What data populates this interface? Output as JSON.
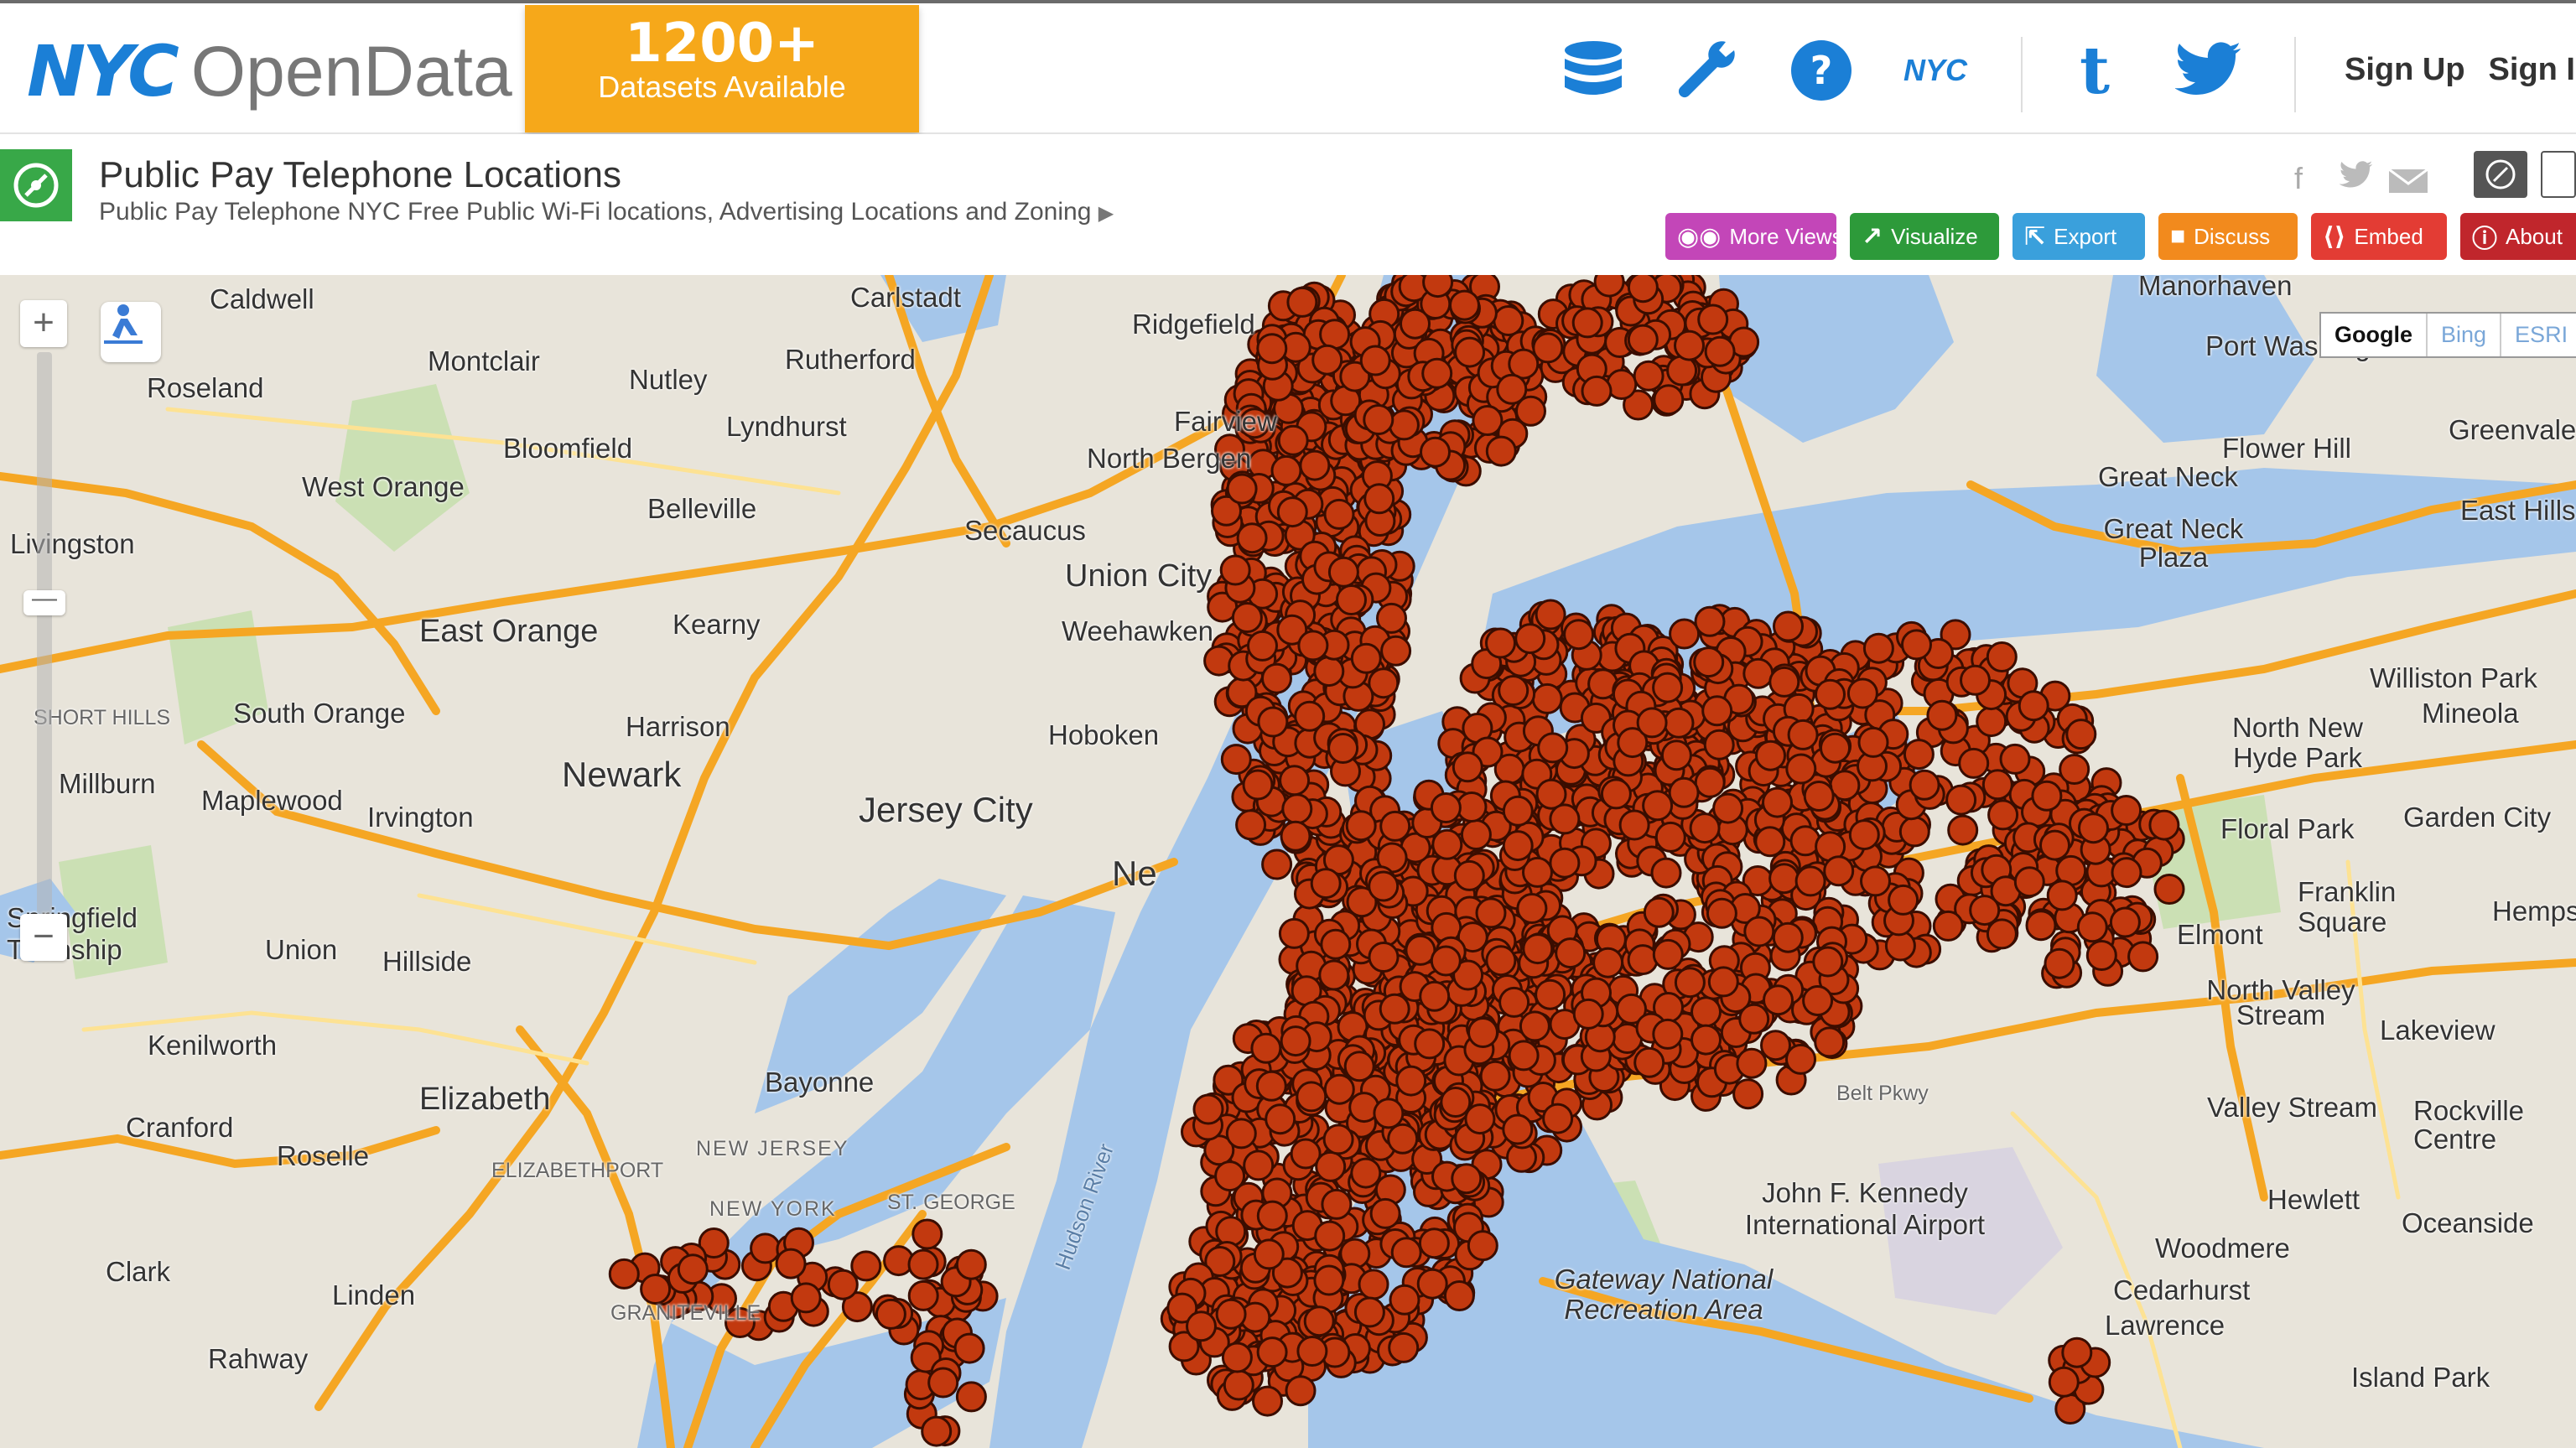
{
  "header": {
    "logo_nyc": "NYC",
    "logo_opendata": "OpenData",
    "badge_count": "1200+",
    "badge_text": "Datasets Available",
    "icons": [
      "database-icon",
      "wrench-icon",
      "help-icon",
      "nyc-icon",
      "tumblr-icon",
      "twitter-icon"
    ],
    "nyc_icon_text": "NYC",
    "tumblr_icon_text": "t",
    "sign_up": "Sign Up",
    "sign_in": "Sign In"
  },
  "dataset": {
    "title": "Public Pay Telephone Locations",
    "subtitle": "Public Pay Telephone NYC Free Public Wi-Fi locations, Advertising Locations and Zoning",
    "share_icons": [
      "facebook-icon",
      "twitter-icon",
      "email-icon"
    ],
    "buttons": [
      {
        "label": "More Views",
        "color": "#c346b8",
        "icon": "binoculars-icon"
      },
      {
        "label": "Visualize",
        "color": "#2d9a3a",
        "icon": "chart-icon"
      },
      {
        "label": "Export",
        "color": "#3aa0dc",
        "icon": "export-icon"
      },
      {
        "label": "Discuss",
        "color": "#f28a1d",
        "icon": "speech-icon"
      },
      {
        "label": "Embed",
        "color": "#e33c34",
        "icon": "code-icon"
      },
      {
        "label": "About",
        "color": "#c0262c",
        "icon": "info-icon"
      }
    ]
  },
  "map": {
    "providers": [
      "Google",
      "Bing",
      "ESRI"
    ],
    "selected_provider": "Google",
    "zoom_in": "+",
    "zoom_out": "−",
    "water_color": "#a5c6ea",
    "land_color": "#e8e4da",
    "marker_color": "#c2390f",
    "labels": [
      "Caldwell",
      "Carlstadt",
      "Ridgefield",
      "Manorhaven",
      "Port Washington",
      "Roseland",
      "Montclair",
      "Nutley",
      "Rutherford",
      "Lyndhurst",
      "Fairview",
      "North Bergen",
      "Greenvale",
      "Flower Hill",
      "Great Neck",
      "East Hills",
      "Great Neck Plaza",
      "West Orange",
      "Bloomfield",
      "Belleville",
      "Secaucus",
      "Livingston",
      "Union City",
      "East Orange",
      "Kearny",
      "Weehawken",
      "Williston Park",
      "Mineola",
      "North New Hyde Park",
      "South Orange",
      "Harrison",
      "Hoboken",
      "Newark",
      "Floral Park",
      "Garden City",
      "Millburn",
      "Maplewood",
      "Irvington",
      "Jersey City",
      "Franklin Square",
      "Hempstead",
      "Elmont",
      "Springfield Township",
      "Union",
      "Hillside",
      "North Valley Stream",
      "Lakeview",
      "Kenilworth",
      "Bayonne",
      "Valley Stream",
      "Rockville Centre",
      "Elizabeth",
      "Cranford",
      "Roselle",
      "John F. Kennedy International Airport",
      "Hewlett",
      "Oceanside",
      "Woodmere",
      "Clark",
      "Linden",
      "Gateway National Recreation Area",
      "Cedarhurst",
      "Lawrence",
      "Rahway",
      "Island Park",
      "Hudson River",
      "New Jersey",
      "New York",
      "Belt Pkwy",
      "Short Hills",
      "Elizabethport",
      "Graniteville",
      "St. George",
      "Ne"
    ]
  }
}
